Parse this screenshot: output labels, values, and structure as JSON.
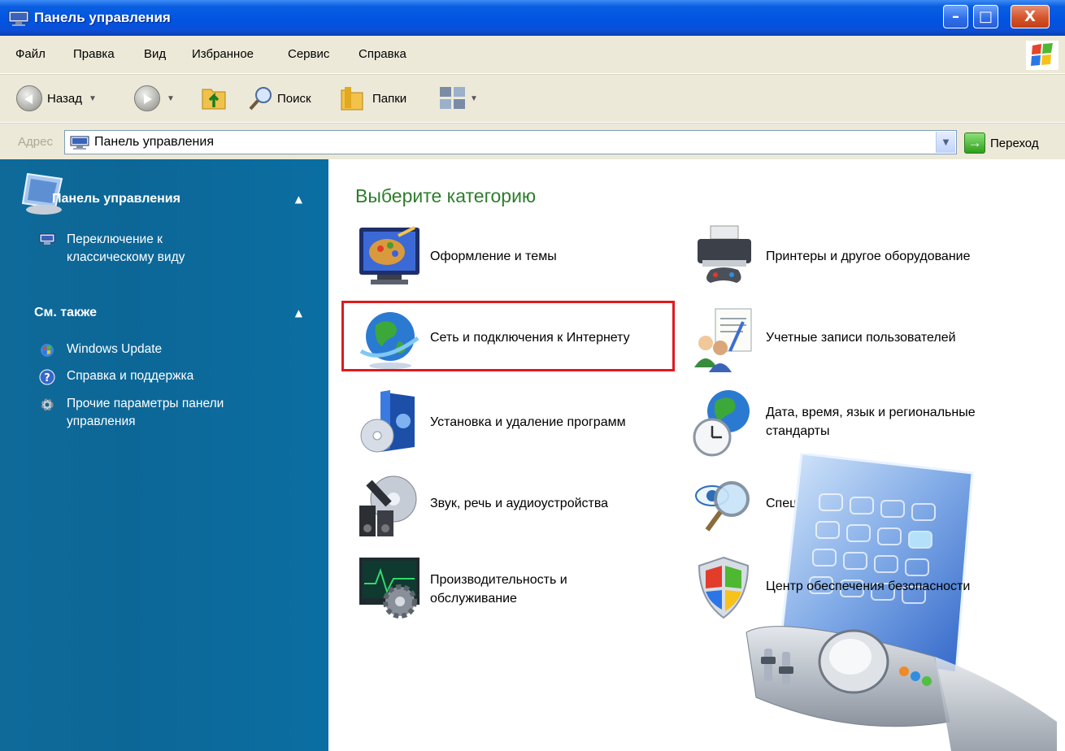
{
  "window": {
    "title": "Панель управления",
    "controls": {
      "minimize": "–",
      "maximize": "□",
      "close": "X"
    }
  },
  "menu": [
    "Файл",
    "Правка",
    "Вид",
    "Избранное",
    "Сервис",
    "Справка"
  ],
  "toolbar": {
    "back_label": "Назад",
    "search_label": "Поиск",
    "folders_label": "Папки"
  },
  "address": {
    "label": "Адрес",
    "value": "Панель управления",
    "go_label": "Переход"
  },
  "sidebar": {
    "panel_title": "Панель управления",
    "switch_view": "Переключение к классическому виду",
    "see_also_title": "См. также",
    "links": [
      "Windows Update",
      "Справка и поддержка",
      "Прочие параметры панели управления"
    ]
  },
  "main": {
    "heading": "Выберите категорию",
    "categories_left": [
      "Оформление и темы",
      "Сеть и подключения к Интернету",
      "Установка и удаление программ",
      "Звук, речь и аудиоустройства",
      "Производительность и обслуживание"
    ],
    "categories_right": [
      "Принтеры и другое оборудование",
      "Учетные записи пользователей",
      "Дата, время, язык и региональные стандарты",
      "Специальные возможности",
      "Центр обеспечения безопасности"
    ]
  },
  "highlight_color": "#e0191e",
  "heading_color": "#2d7d2c",
  "sidebar_color": "#0c6797"
}
